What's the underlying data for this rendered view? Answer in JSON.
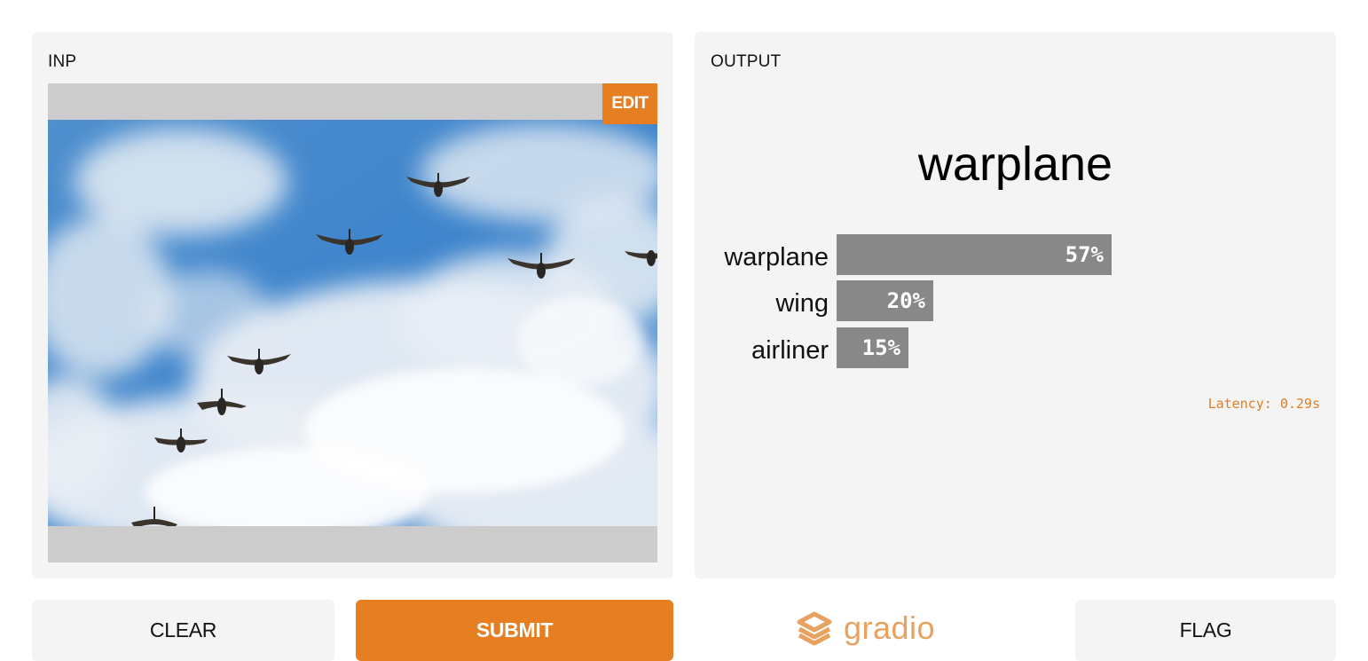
{
  "input": {
    "label": "INP",
    "edit_label": "EDIT"
  },
  "output": {
    "label": "OUTPUT",
    "top_label": "warplane",
    "confidences": [
      {
        "label": "warplane",
        "percent_text": "57%",
        "value": 0.57
      },
      {
        "label": "wing",
        "percent_text": "20%",
        "value": 0.2
      },
      {
        "label": "airliner",
        "percent_text": "15%",
        "value": 0.15
      }
    ],
    "latency": "Latency: 0.29s"
  },
  "buttons": {
    "clear": "CLEAR",
    "submit": "SUBMIT",
    "flag": "FLAG"
  },
  "brand": {
    "name": "gradio",
    "icon": "gradio-logo-icon",
    "color": "#e8a25f"
  },
  "colors": {
    "accent": "#e67e22",
    "panel": "#f4f4f4",
    "bar": "#888888"
  }
}
